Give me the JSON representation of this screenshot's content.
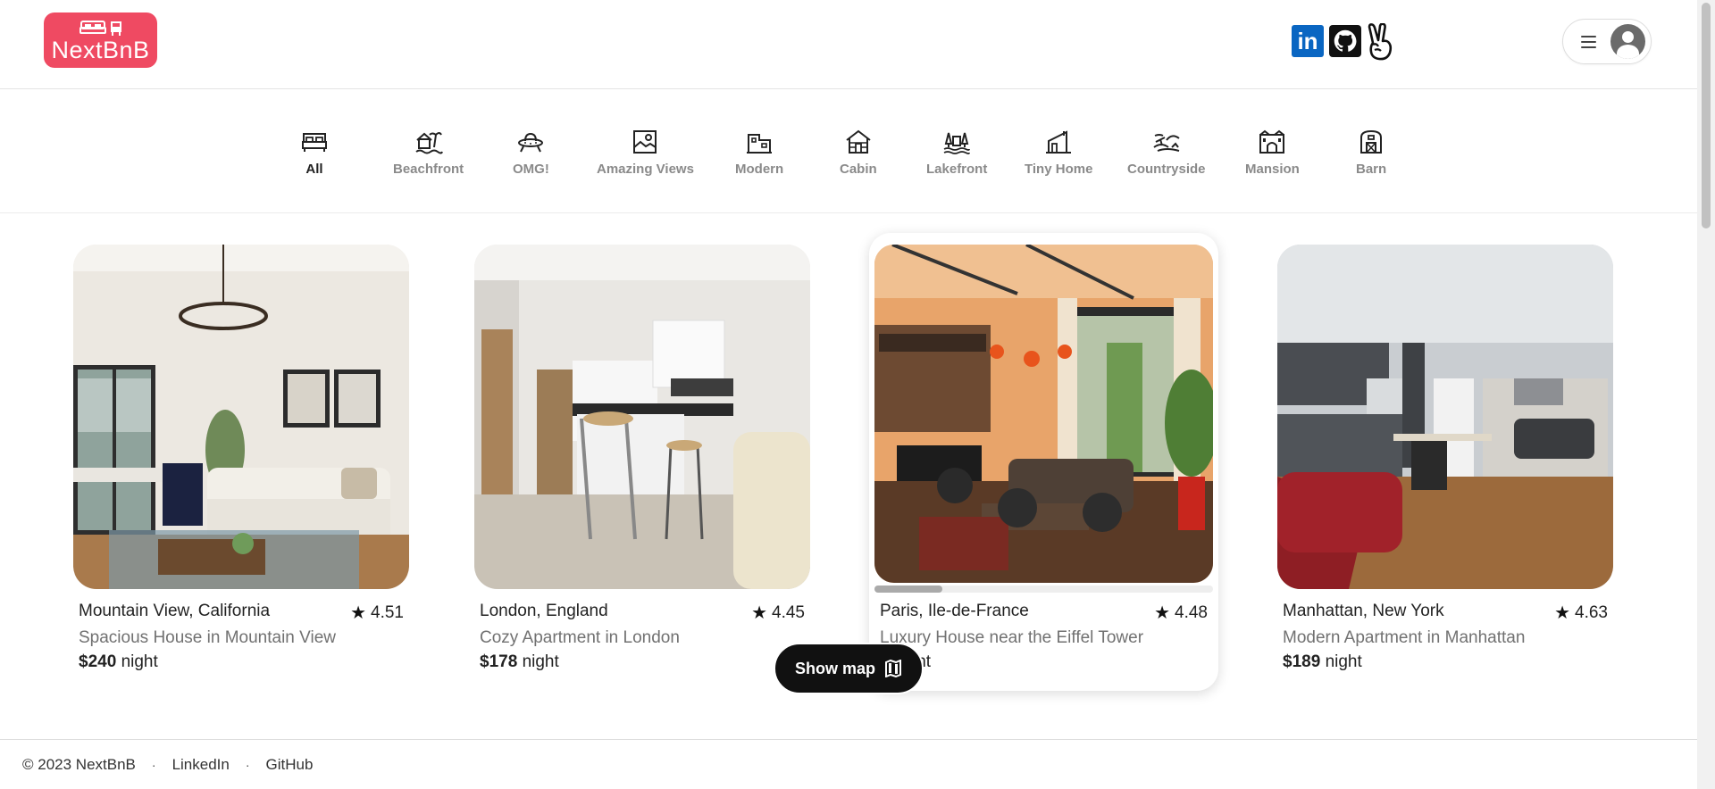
{
  "header": {
    "logo_text": "NextBnB",
    "social": [
      "linkedin-icon",
      "github-icon",
      "peace-hand-icon"
    ],
    "linkedin_label": "in"
  },
  "categories": [
    {
      "label": "All",
      "icon": "bed-icon",
      "active": true
    },
    {
      "label": "Beachfront",
      "icon": "beach-icon"
    },
    {
      "label": "OMG!",
      "icon": "ufo-icon"
    },
    {
      "label": "Amazing Views",
      "icon": "views-icon"
    },
    {
      "label": "Modern",
      "icon": "modern-icon"
    },
    {
      "label": "Cabin",
      "icon": "cabin-icon"
    },
    {
      "label": "Lakefront",
      "icon": "lakefront-icon"
    },
    {
      "label": "Tiny Home",
      "icon": "tiny-home-icon"
    },
    {
      "label": "Countryside",
      "icon": "countryside-icon"
    },
    {
      "label": "Mansion",
      "icon": "mansion-icon"
    },
    {
      "label": "Barn",
      "icon": "barn-icon"
    }
  ],
  "listings": [
    {
      "location": "Mountain View, California",
      "rating": "4.51",
      "title": "Spacious House in Mountain View",
      "price": "$240",
      "unit": "night"
    },
    {
      "location": "London, England",
      "rating": "4.45",
      "title": "Cozy Apartment in London",
      "price": "$178",
      "unit": "night"
    },
    {
      "location": "Paris, Ile-de-France",
      "rating": "4.48",
      "title": "Luxury House near the Eiffel Tower",
      "price": "$",
      "unit": "night"
    },
    {
      "location": "Manhattan, New York",
      "rating": "4.63",
      "title": "Modern Apartment in Manhattan",
      "price": "$189",
      "unit": "night"
    }
  ],
  "show_map": {
    "label": "Show map"
  },
  "footer": {
    "copyright": "© 2023 NextBnB",
    "links": [
      "LinkedIn",
      "GitHub"
    ],
    "separator": "·"
  }
}
